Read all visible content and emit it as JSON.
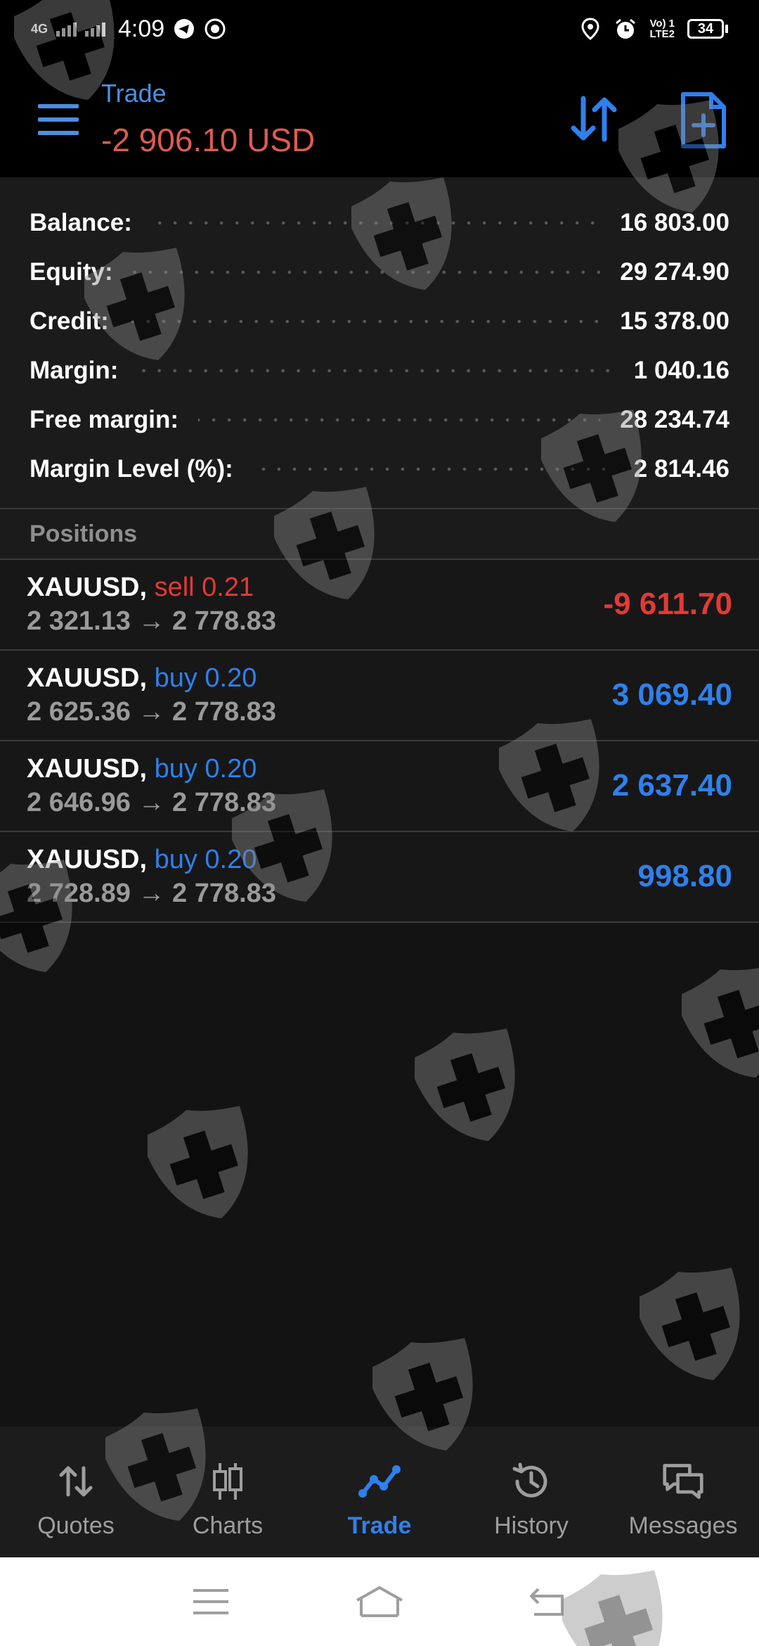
{
  "status_bar": {
    "network": "4G",
    "time": "4:09",
    "lte_line1": "Vo) 1",
    "lte_line2": "LTE2",
    "battery": "34"
  },
  "header": {
    "title": "Trade",
    "amount": "-2 906.10 USD"
  },
  "summary": {
    "balance_label": "Balance:",
    "balance_value": "16 803.00",
    "equity_label": "Equity:",
    "equity_value": "29 274.90",
    "credit_label": "Credit:",
    "credit_value": "15 378.00",
    "margin_label": "Margin:",
    "margin_value": "1 040.16",
    "free_margin_label": "Free margin:",
    "free_margin_value": "28 234.74",
    "margin_level_label": "Margin Level (%):",
    "margin_level_value": "2 814.46"
  },
  "positions": {
    "header": "Positions",
    "items": [
      {
        "symbol": "XAUUSD,",
        "side": "sell 0.21",
        "prices": "2 321.13 → 2 778.83",
        "profit": "-9 611.70"
      },
      {
        "symbol": "XAUUSD,",
        "side": "buy 0.20",
        "prices": "2 625.36 → 2 778.83",
        "profit": "3 069.40"
      },
      {
        "symbol": "XAUUSD,",
        "side": "buy 0.20",
        "prices": "2 646.96 → 2 778.83",
        "profit": "2 637.40"
      },
      {
        "symbol": "XAUUSD,",
        "side": "buy 0.20",
        "prices": "2 728.89 → 2 778.83",
        "profit": "998.80"
      }
    ]
  },
  "bottom_nav": {
    "quotes": "Quotes",
    "charts": "Charts",
    "trade": "Trade",
    "history": "History",
    "messages": "Messages"
  },
  "colors": {
    "accent_blue": "#2f80ed",
    "loss_red": "#e53935",
    "header_amount": "#e05a50"
  },
  "icons": {
    "hamburger": "menu-icon",
    "sort": "sort-arrows-icon",
    "new_order": "new-document-icon",
    "quotes": "up-down-arrows-icon",
    "charts": "candlestick-icon",
    "trade": "trend-line-icon",
    "history": "clock-history-icon",
    "messages": "chat-bubbles-icon",
    "watermark": "shield-cross-icon"
  }
}
